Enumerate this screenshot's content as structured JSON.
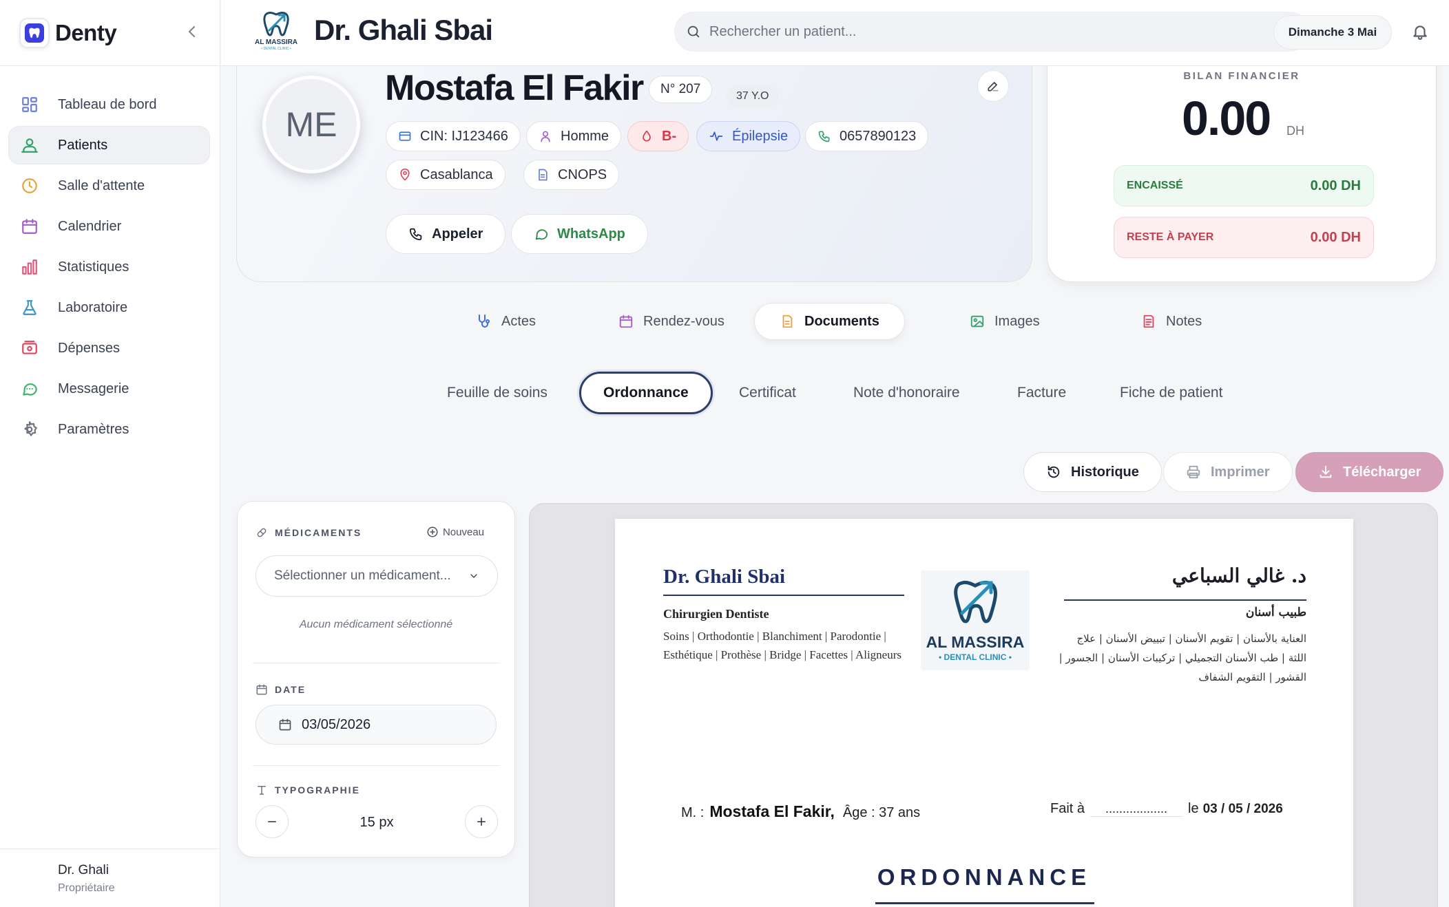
{
  "app": {
    "name": "Denty"
  },
  "sidebar": {
    "items": [
      {
        "label": "Tableau de bord",
        "icon": "dashboard-icon",
        "color": "#6b7fd7"
      },
      {
        "label": "Patients",
        "icon": "users-icon",
        "color": "#2fa36b",
        "active": true
      },
      {
        "label": "Salle d'attente",
        "icon": "clock-icon",
        "color": "#e8a33d"
      },
      {
        "label": "Calendrier",
        "icon": "calendar-icon",
        "color": "#a65bc9"
      },
      {
        "label": "Statistiques",
        "icon": "chart-icon",
        "color": "#e05a7a"
      },
      {
        "label": "Laboratoire",
        "icon": "flask-icon",
        "color": "#3b95c6"
      },
      {
        "label": "Dépenses",
        "icon": "wallet-icon",
        "color": "#e0475d"
      },
      {
        "label": "Messagerie",
        "icon": "message-icon",
        "color": "#38b56a"
      },
      {
        "label": "Paramètres",
        "icon": "gear-icon",
        "color": "#6e7480"
      }
    ],
    "user": {
      "name": "Dr. Ghali",
      "role": "Propriétaire"
    }
  },
  "header": {
    "clinic_logo_text": "AL MASSIRA",
    "clinic_logo_sub": "• DENTAL CLINIC •",
    "doctor": "Dr. Ghali Sbai",
    "search_placeholder": "Rechercher un patient...",
    "date": "Dimanche 3 Mai"
  },
  "patient": {
    "initials": "ME",
    "name": "Mostafa El Fakir",
    "number": "N° 207",
    "age": "37 Y.O",
    "cin": "CIN: IJ123466",
    "gender": "Homme",
    "blood": "B-",
    "condition": "Épilepsie",
    "phone": "0657890123",
    "city": "Casablanca",
    "insurance": "CNOPS",
    "call_label": "Appeler",
    "whatsapp_label": "WhatsApp"
  },
  "finance": {
    "title": "BILAN FINANCIER",
    "total": "0.00",
    "unit": "DH",
    "paid_label": "ENCAISSÉ",
    "paid_value": "0.00 DH",
    "due_label": "RESTE À PAYER",
    "due_value": "0.00 DH"
  },
  "tabs": [
    "Actes",
    "Rendez-vous",
    "Documents",
    "Images",
    "Notes"
  ],
  "subtabs": [
    "Feuille de soins",
    "Ordonnance",
    "Certificat",
    "Note d'honoraire",
    "Facture",
    "Fiche de patient"
  ],
  "toolbar": {
    "history": "Historique",
    "print": "Imprimer",
    "download": "Télécharger"
  },
  "prescription_panel": {
    "meds_label": "MÉDICAMENTS",
    "new_label": "Nouveau",
    "select_placeholder": "Sélectionner un médicament...",
    "empty": "Aucun médicament sélectionné",
    "date_label": "DATE",
    "date_value": "03/05/2026",
    "typo_label": "TYPOGRAPHIE",
    "font_size": "15 px"
  },
  "document": {
    "fr_name": "Dr. Ghali Sbai",
    "fr_title": "Chirurgien Dentiste",
    "fr_specialties": "Soins | Orthodontie | Blanchiment | Parodontie | Esthétique | Prothèse | Bridge | Facettes | Aligneurs",
    "ar_name": "د. غالي السباعي",
    "ar_title": "طبيب أسنان",
    "ar_specialties": "العناية بالأسنان | تقويم الأسنان | تبييض الأسنان | علاج اللثة | طب الأسنان التجميلي | تركيبات الأسنان | الجسور | القشور | التقويم الشفاف",
    "logo_text": "AL MASSIRA",
    "logo_sub": "• DENTAL CLINIC •",
    "patient_prefix": "M. :",
    "patient_name": "Mostafa El Fakir,",
    "patient_age": "Âge : 37 ans",
    "place_prefix": "Fait à",
    "place_dots": "..................",
    "date_prefix": "le",
    "date": "03 / 05 / 2026",
    "heading": "ORDONNANCE"
  }
}
